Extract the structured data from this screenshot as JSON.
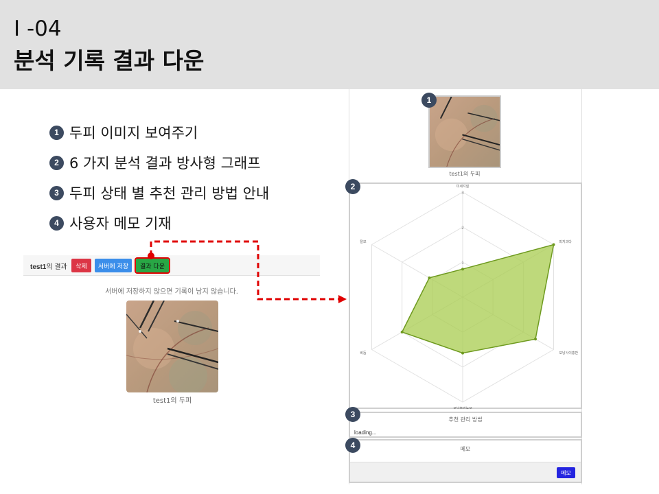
{
  "header": {
    "code": "I -04",
    "title": "분석 기록 결과 다운"
  },
  "bullets": [
    {
      "num": "1",
      "text": "두피 이미지 보여주기"
    },
    {
      "num": "2",
      "text": "6 가지 분석 결과 방사형 그래프"
    },
    {
      "num": "3",
      "text": "두피 상태 별 추천 관리 방법 안내"
    },
    {
      "num": "4",
      "text": "사용자 메모 기재"
    }
  ],
  "result_page": {
    "user": "test1",
    "title_suffix": "의 결과",
    "buttons": {
      "delete": "삭제",
      "save": "서버에 저장",
      "download": "결과 다운"
    },
    "save_note": "서버에 저장하지 않으면 기록이 남지 않습니다.",
    "caption_user": "test1",
    "caption_suffix": "의 두피"
  },
  "mobile_view": {
    "caption": "test1의 두피",
    "recommend_title": "추천 관리 방법",
    "loading": "loading...",
    "memo_title": "메모",
    "memo_button": "메모"
  },
  "badges": [
    "1",
    "2",
    "3",
    "4"
  ],
  "colors": {
    "radar_fill": "#a8cc4f",
    "radar_stroke": "#6e9a1f",
    "badge": "#3c4a60",
    "highlight": "#e00000"
  },
  "chart_data": {
    "type": "radar",
    "axes": [
      "미세각질",
      "피지과다",
      "모낭사이홍반",
      "모낭홍반농포",
      "비듬",
      "탈모"
    ],
    "ticks": [
      1,
      2,
      3
    ],
    "rmax": 3,
    "values": [
      0.8,
      3.0,
      2.4,
      1.6,
      2.0,
      1.1
    ],
    "grid": true
  }
}
